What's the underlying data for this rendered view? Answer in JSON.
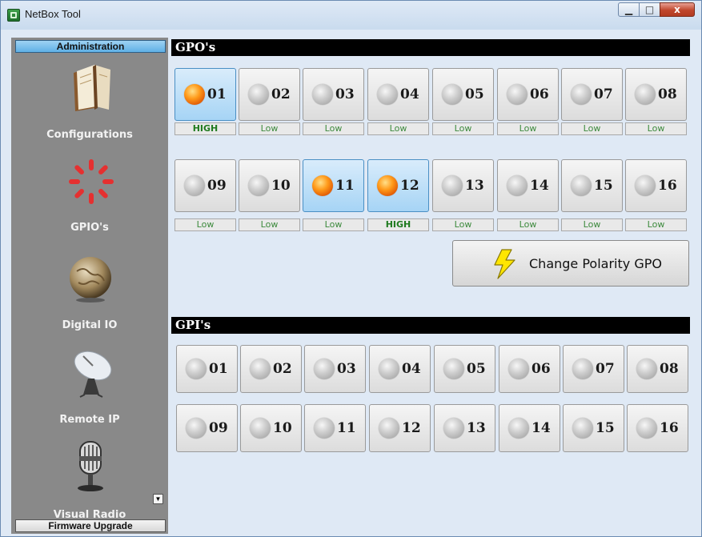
{
  "window": {
    "title": "NetBox Tool",
    "min": "▁",
    "max": "□",
    "close": "x"
  },
  "sidebar": {
    "top_label": "Administration",
    "bottom_label": "Firmware Upgrade",
    "items": [
      {
        "label": "Configurations",
        "icon": "book-icon"
      },
      {
        "label": "GPIO's",
        "icon": "gpio-spinner-icon"
      },
      {
        "label": "Digital IO",
        "icon": "globe-icon"
      },
      {
        "label": "Remote IP",
        "icon": "satellite-dish-icon"
      },
      {
        "label": "Visual Radio",
        "icon": "microphone-icon"
      }
    ]
  },
  "gpo": {
    "header": "GPO's",
    "outputs": [
      {
        "num": "01",
        "state": "HIGH",
        "active": true
      },
      {
        "num": "02",
        "state": "Low",
        "active": false
      },
      {
        "num": "03",
        "state": "Low",
        "active": false
      },
      {
        "num": "04",
        "state": "Low",
        "active": false
      },
      {
        "num": "05",
        "state": "Low",
        "active": false
      },
      {
        "num": "06",
        "state": "Low",
        "active": false
      },
      {
        "num": "07",
        "state": "Low",
        "active": false
      },
      {
        "num": "08",
        "state": "Low",
        "active": false
      },
      {
        "num": "09",
        "state": "Low",
        "active": false
      },
      {
        "num": "10",
        "state": "Low",
        "active": false
      },
      {
        "num": "11",
        "state": "Low",
        "active": true
      },
      {
        "num": "12",
        "state": "HIGH",
        "active": true
      },
      {
        "num": "13",
        "state": "Low",
        "active": false
      },
      {
        "num": "14",
        "state": "Low",
        "active": false
      },
      {
        "num": "15",
        "state": "Low",
        "active": false
      },
      {
        "num": "16",
        "state": "Low",
        "active": false
      }
    ],
    "polarity_button": "Change Polarity GPO"
  },
  "gpi": {
    "header": "GPI's",
    "inputs": [
      "01",
      "02",
      "03",
      "04",
      "05",
      "06",
      "07",
      "08",
      "09",
      "10",
      "11",
      "12",
      "13",
      "14",
      "15",
      "16"
    ]
  },
  "colors": {
    "active_led": "#ff9a1a",
    "active_button": "#a6d4f5",
    "sidebar_bg": "#898989",
    "high_text": "#1f7a1f"
  }
}
